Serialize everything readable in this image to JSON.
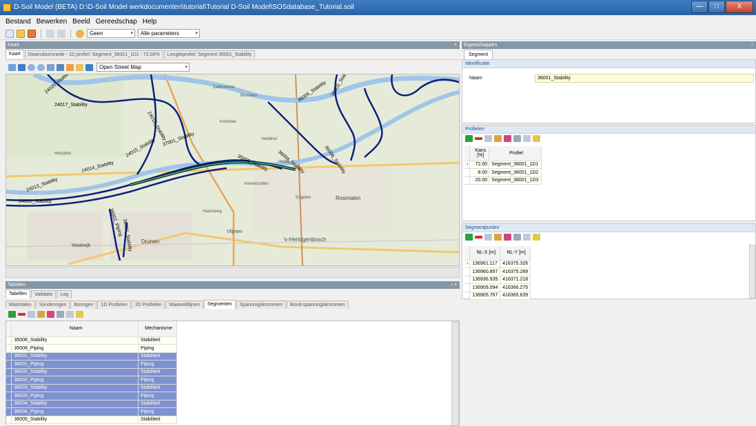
{
  "window": {
    "title": "D-Soil Model (BETA)  D:\\D-Soil Model werkdocumenten\\tutorial\\Tutorial D-Soil Model\\SOSdatabase_Tutorial.soil",
    "min": "—",
    "max": "□",
    "close": "X"
  },
  "menu": [
    "Bestand",
    "Bewerken",
    "Beeld",
    "Gereedschap",
    "Help"
  ],
  "toolbar": {
    "combo1": "Geen",
    "combo2": "Alle parameters"
  },
  "map_panel": {
    "header": "Kaart",
    "close": "×",
    "tabs": [
      "Kaart",
      "Dwarsdoorsnede - 1D profiel: Segment_36001_1D1 - 72.00%",
      "Lengteprofiel: Segment 36001_Stability"
    ],
    "layer_combo": "Open Street Map",
    "labels": [
      "24020_Stability",
      "24017_Stability",
      "24016_Stability",
      "24015_Stability",
      "24014_Stability",
      "24013_Stability",
      "24012_Stability",
      "36002_Piping",
      "36001_Stability",
      "37001_Stability",
      "36005_Stability",
      "36004_Stability",
      "35005_Stability",
      "36006_Stability",
      "36003_Stability"
    ],
    "places": [
      "Waalwijk",
      "Drunen",
      "Vlijmen",
      "'s-Hertogenbosch",
      "Rosmalen",
      "Heusden",
      "Kerkdriel",
      "Zaltbommel",
      "Bruchem",
      "Velddriel",
      "Hedel",
      "Ammerzoden",
      "Haarsteeg",
      "Engelen"
    ]
  },
  "tables_panel": {
    "header": "Tabellen",
    "controls": "↕ ×",
    "top_tabs": [
      "Tabellen",
      "Validatie",
      "Log"
    ],
    "tabs": [
      "Materialen",
      "Sonderingen",
      "Boringen",
      "1D Profielen",
      "2D Profielen",
      "Maaiveldlijnen",
      "Segmenten",
      "Spanningskrommen",
      "Bond-spanningskrommen"
    ],
    "active_tab": "Segmenten",
    "columns": [
      "Naam",
      "Mechanisme"
    ],
    "rows": [
      {
        "name": "35008_Stability",
        "mech": "Stabiliteit",
        "selected": false
      },
      {
        "name": "35008_Piping",
        "mech": "Piping",
        "selected": false
      },
      {
        "name": "36001_Stability",
        "mech": "Stabiliteit",
        "selected": true
      },
      {
        "name": "36001_Piping",
        "mech": "Piping",
        "selected": true
      },
      {
        "name": "36002_Stability",
        "mech": "Stabiliteit",
        "selected": true
      },
      {
        "name": "36002_Piping",
        "mech": "Piping",
        "selected": true
      },
      {
        "name": "36003_Stability",
        "mech": "Stabiliteit",
        "selected": true
      },
      {
        "name": "36003_Piping",
        "mech": "Piping",
        "selected": true
      },
      {
        "name": "36004_Stability",
        "mech": "Stabiliteit",
        "selected": true
      },
      {
        "name": "36004_Piping",
        "mech": "Piping",
        "selected": true
      },
      {
        "name": "36005_Stability",
        "mech": "Stabiliteit",
        "selected": false
      }
    ]
  },
  "properties": {
    "header": "Eigenschappen",
    "pin": "↕",
    "tab": "Segment",
    "section": "Identificatie",
    "name_label": "Naam",
    "name_value": "36001_Stability"
  },
  "profiles": {
    "header": "Profielen",
    "col_kans": "Kans [%]",
    "col_profiel": "Profiel",
    "rows": [
      {
        "kans": "72.00",
        "profiel": "Segment_36001_1D1"
      },
      {
        "kans": "8.00",
        "profiel": "Segment_36001_1D2"
      },
      {
        "kans": "20.00",
        "profiel": "Segment_36001_1D3"
      }
    ]
  },
  "segmentpoints": {
    "header": "Segmentpunten",
    "col_x": "NL-X [m]",
    "col_y": "NL-Y [m]",
    "rows": [
      {
        "x": "136961.117",
        "y": "416375.326"
      },
      {
        "x": "136960.897",
        "y": "416375.289"
      },
      {
        "x": "136936.935",
        "y": "416371.218"
      },
      {
        "x": "136909.094",
        "y": "416366.275"
      },
      {
        "x": "136905.767",
        "y": "416365.639"
      }
    ]
  },
  "colors": {
    "accent": "#7e92cf",
    "panel_header": "#8497a6",
    "river": "#9fc5e8",
    "segment": "#0b1f7a"
  }
}
